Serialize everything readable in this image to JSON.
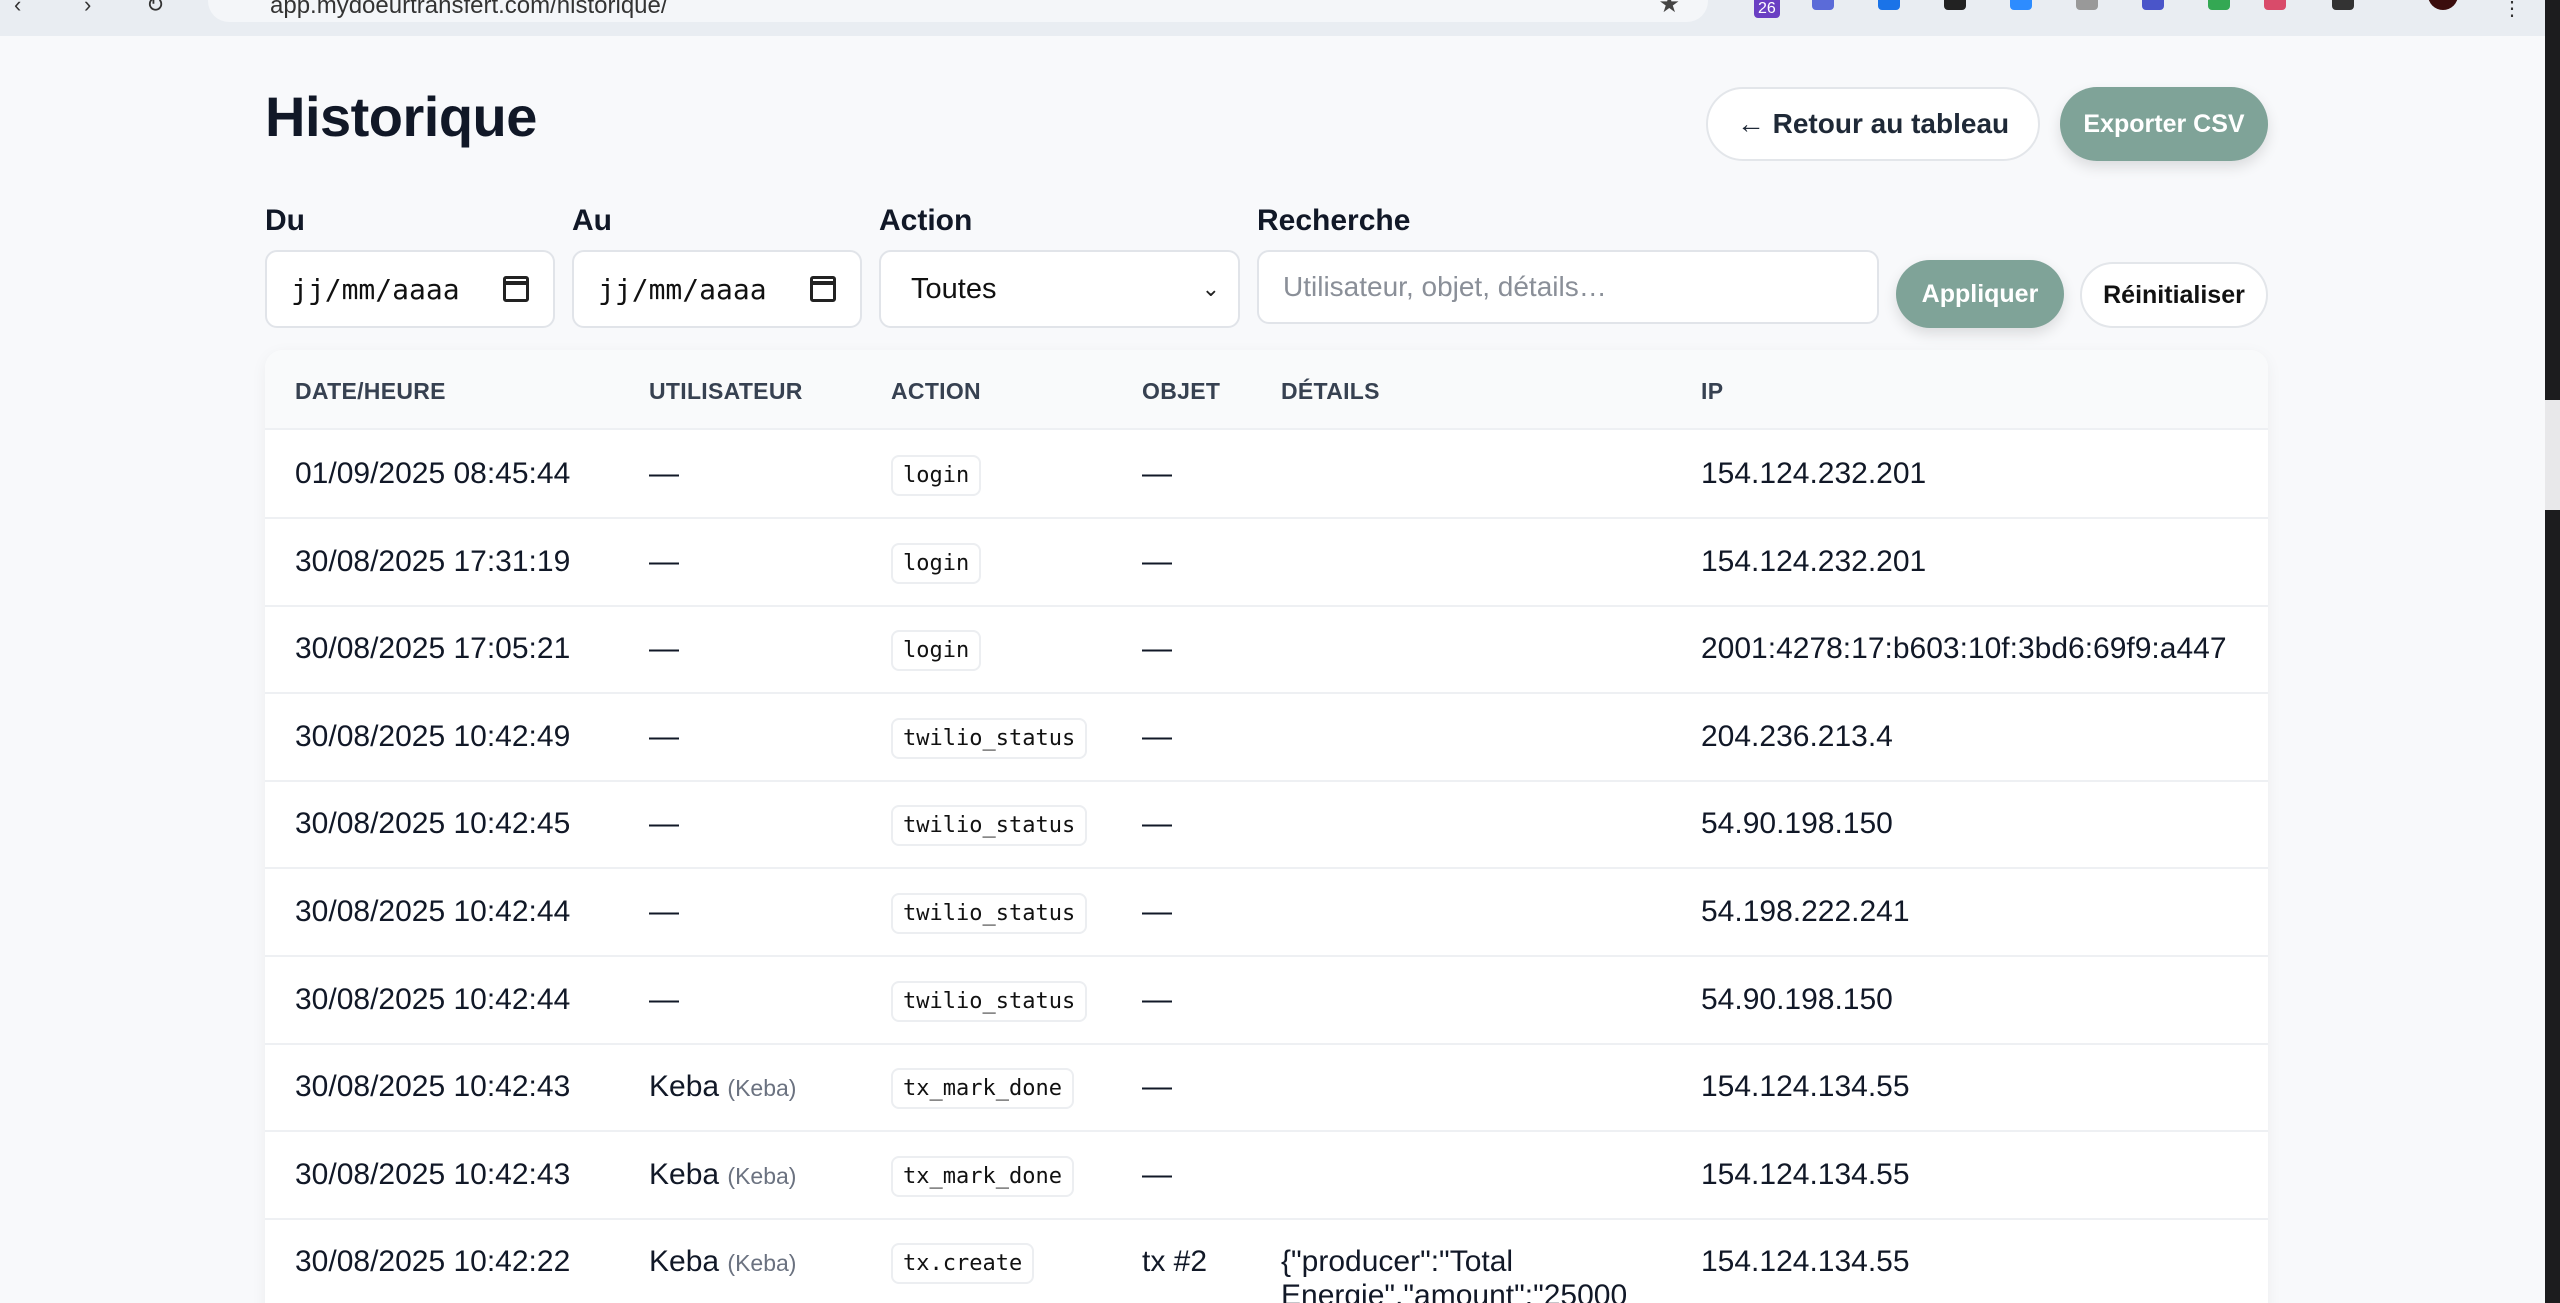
{
  "browser": {
    "url": "app.mydoeurtransfert.com/historique/",
    "extension_badge": "26"
  },
  "page": {
    "title": "Historique",
    "back_button": "← Retour au tableau",
    "export_button": "Exporter CSV"
  },
  "filters": {
    "from_label": "Du",
    "from_value": "jj/mm/aaaa",
    "to_label": "Au",
    "to_value": "jj/mm/aaaa",
    "action_label": "Action",
    "action_value": "Toutes",
    "search_label": "Recherche",
    "search_placeholder": "Utilisateur, objet, détails…",
    "apply_button": "Appliquer",
    "reset_button": "Réinitialiser"
  },
  "table": {
    "columns": [
      "DATE/HEURE",
      "UTILISATEUR",
      "ACTION",
      "OBJET",
      "DÉTAILS",
      "IP"
    ],
    "rows": [
      {
        "datetime": "01/09/2025 08:45:44",
        "user": "—",
        "user_sub": "",
        "action": "login",
        "object": "—",
        "details": "",
        "ip": "154.124.232.201"
      },
      {
        "datetime": "30/08/2025 17:31:19",
        "user": "—",
        "user_sub": "",
        "action": "login",
        "object": "—",
        "details": "",
        "ip": "154.124.232.201"
      },
      {
        "datetime": "30/08/2025 17:05:21",
        "user": "—",
        "user_sub": "",
        "action": "login",
        "object": "—",
        "details": "",
        "ip": "2001:4278:17:b603:10f:3bd6:69f9:a447"
      },
      {
        "datetime": "30/08/2025 10:42:49",
        "user": "—",
        "user_sub": "",
        "action": "twilio_status",
        "object": "—",
        "details": "",
        "ip": "204.236.213.4"
      },
      {
        "datetime": "30/08/2025 10:42:45",
        "user": "—",
        "user_sub": "",
        "action": "twilio_status",
        "object": "—",
        "details": "",
        "ip": "54.90.198.150"
      },
      {
        "datetime": "30/08/2025 10:42:44",
        "user": "—",
        "user_sub": "",
        "action": "twilio_status",
        "object": "—",
        "details": "",
        "ip": "54.198.222.241"
      },
      {
        "datetime": "30/08/2025 10:42:44",
        "user": "—",
        "user_sub": "",
        "action": "twilio_status",
        "object": "—",
        "details": "",
        "ip": "54.90.198.150"
      },
      {
        "datetime": "30/08/2025 10:42:43",
        "user": "Keba",
        "user_sub": "(Keba)",
        "action": "tx_mark_done",
        "object": "—",
        "details": "",
        "ip": "154.124.134.55"
      },
      {
        "datetime": "30/08/2025 10:42:43",
        "user": "Keba",
        "user_sub": "(Keba)",
        "action": "tx_mark_done",
        "object": "—",
        "details": "",
        "ip": "154.124.134.55"
      },
      {
        "datetime": "30/08/2025 10:42:22",
        "user": "Keba",
        "user_sub": "(Keba)",
        "action": "tx.create",
        "object": "tx #2",
        "details": "{\"producer\":\"Total Energie\",\"amount\":\"25000",
        "ip": "154.124.134.55"
      }
    ]
  }
}
